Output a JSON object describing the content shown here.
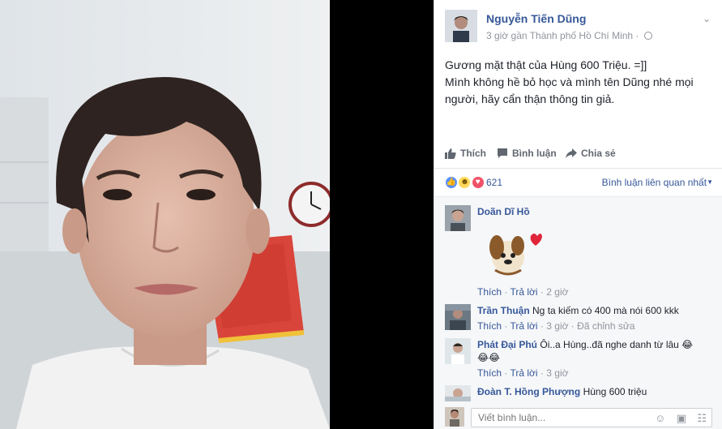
{
  "post": {
    "author": "Nguyễn Tiến Dũng",
    "meta": "3 giờ gần Thành phố Hồ Chí Minh ·",
    "text_lines": [
      "Gương mặt thật của Hùng 600 Triệu. =]]",
      "Mình không hề bỏ học và mình tên Dũng nhé mọi",
      "người, hãy cẩn thận thông tin giả."
    ]
  },
  "actions": {
    "like": "Thích",
    "comment": "Bình luận",
    "share": "Chia sẻ"
  },
  "reactions": {
    "count": "621",
    "sort_label": "Bình luận liên quan nhất"
  },
  "comments": [
    {
      "name": "Doãn Dĩ Hồ",
      "text": "",
      "like_label": "Thích",
      "reply_label": "Trả lời",
      "time": "2 giờ",
      "sticker": "dog-sticker"
    },
    {
      "name": "Trần Thuận",
      "text": "Ng ta kiếm có 400 mà nói 600 kkk",
      "like_label": "Thích",
      "reply_label": "Trả lời",
      "time": "3 giờ",
      "edited": "Đã chỉnh sửa"
    },
    {
      "name": "Phát Đại Phú",
      "text": "Ôi..a Hùng..đã nghe danh từ lâu 😂",
      "text2": "😂😂",
      "like_label": "Thích",
      "reply_label": "Trả lời",
      "time": "3 giờ"
    },
    {
      "name": "Đoàn T. Hồng Phượng",
      "text": "Hùng 600 triệu"
    }
  ],
  "comment_box": {
    "placeholder": "Viết bình luận..."
  },
  "icons": {
    "like": "thumbs-up-icon",
    "comment": "speech-bubble-icon",
    "share": "share-arrow-icon",
    "privacy": "globe-icon",
    "menu": "chevron-down-icon",
    "emoji": "smiley-icon",
    "camera": "camera-icon",
    "sticker": "sticker-icon"
  },
  "colors": {
    "link": "#365899",
    "muted": "#90949c",
    "like_reaction": "#5890ff",
    "love_reaction": "#f25268"
  }
}
